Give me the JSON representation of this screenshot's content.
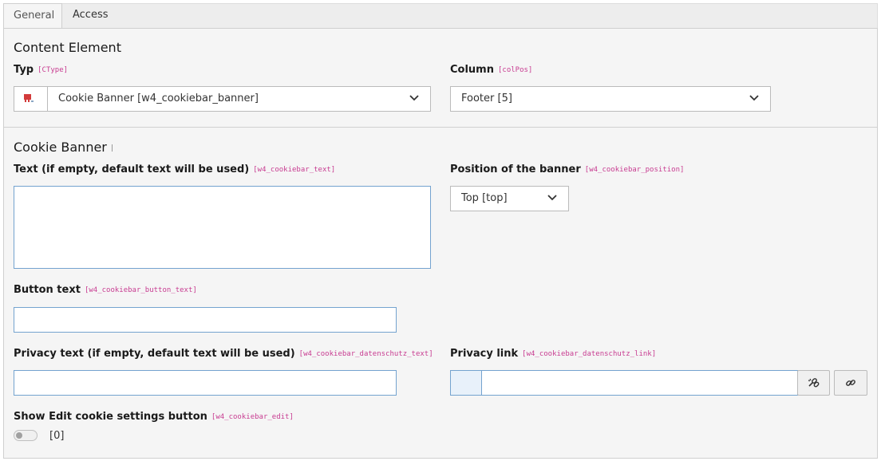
{
  "tabs": [
    {
      "label": "General",
      "active": true
    },
    {
      "label": "Access",
      "active": false
    }
  ],
  "sections": {
    "content_element": {
      "title": "Content Element",
      "typ": {
        "label": "Typ",
        "code": "[CType]",
        "value": "Cookie Banner [w4_cookiebar_banner]",
        "icon": "cookie-banner-content-icon"
      },
      "column": {
        "label": "Column",
        "code": "[colPos]",
        "value": "Footer [5]"
      }
    },
    "cookie_banner": {
      "title": "Cookie Banner",
      "text": {
        "label": "Text (if empty, default text will be used)",
        "code": "[w4_cookiebar_text]",
        "value": ""
      },
      "position": {
        "label": "Position of the banner",
        "code": "[w4_cookiebar_position]",
        "value": "Top [top]"
      },
      "button_text": {
        "label": "Button text",
        "code": "[w4_cookiebar_button_text]",
        "value": ""
      },
      "privacy_text": {
        "label": "Privacy text (if empty, default text will be used)",
        "code": "[w4_cookiebar_datenschutz_text]",
        "value": ""
      },
      "privacy_link": {
        "label": "Privacy link",
        "code": "[w4_cookiebar_datenschutz_link]",
        "value": ""
      },
      "edit_button": {
        "label": "Show Edit cookie settings button",
        "code": "[w4_cookiebar_edit]",
        "value": "[0]",
        "checked": false
      }
    }
  },
  "icons": {
    "chevron": "chevron-down-icon",
    "link_wizard": "link-wizard-icon",
    "link": "link-icon"
  },
  "colors": {
    "field_code": "#c83c91",
    "focus_border": "#74a3cf"
  }
}
